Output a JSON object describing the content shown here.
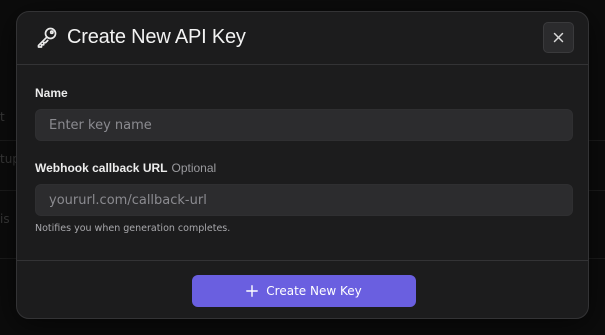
{
  "modal": {
    "title": "Create New API Key",
    "close_icon": "close-icon",
    "title_icon": "key-icon"
  },
  "form": {
    "name": {
      "label": "Name",
      "value": "",
      "placeholder": "Enter key name"
    },
    "webhook": {
      "label": "Webhook callback URL",
      "optional": "Optional",
      "value": "",
      "placeholder": "yoururl.com/callback-url",
      "hint": "Notifies you when generation completes."
    }
  },
  "footer": {
    "create_label": "Create New Key",
    "create_icon": "plus-icon"
  },
  "background": {
    "fragments": [
      "t",
      "tup",
      "is"
    ]
  },
  "colors": {
    "accent": "#6a5fe0",
    "surface": "#1c1c1d",
    "input": "#2c2c2e"
  }
}
